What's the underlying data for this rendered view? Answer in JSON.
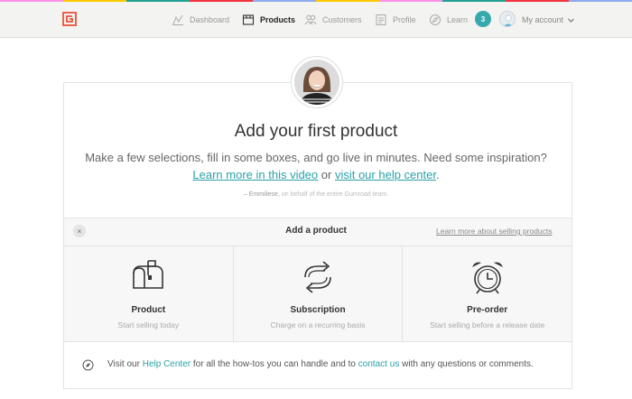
{
  "colors": {
    "rainbow": [
      "#ff90e8",
      "#ffc900",
      "#23a094",
      "#f1333f",
      "#90a8ed",
      "#ffc900",
      "#ff90e8",
      "#23a094",
      "#f1333f",
      "#90a8ed"
    ],
    "accent": "#36a9ae",
    "link": "#2aa1a8"
  },
  "header": {
    "logo_icon": "gumroad-logo-icon",
    "nav": [
      {
        "label": "Dashboard",
        "icon": "chart-icon"
      },
      {
        "label": "Products",
        "icon": "box-icon",
        "active": true
      },
      {
        "label": "Customers",
        "icon": "users-icon"
      },
      {
        "label": "Profile",
        "icon": "profile-icon"
      },
      {
        "label": "Learn",
        "icon": "compass-icon"
      }
    ],
    "notifications_count": "3",
    "account_label": "My account"
  },
  "hero": {
    "title": "Add your first product",
    "subtitle_line1": "Make a few selections, fill in some boxes, and go live in minutes. Need some inspiration?",
    "link_video": "Learn more in this video",
    "or_text": " or ",
    "link_help": "visit our help center",
    "period": ".",
    "signature_name": "– Emmiliese,",
    "signature_rest": " on behalf of the entire Gumroad team."
  },
  "add_product": {
    "close_icon": "×",
    "title": "Add a product",
    "learn_link": "Learn more about selling products"
  },
  "options": [
    {
      "title": "Product",
      "desc": "Start selling today",
      "icon": "mailbox-icon"
    },
    {
      "title": "Subscription",
      "desc": "Charge on a recurring basis",
      "icon": "recurring-arrows-icon"
    },
    {
      "title": "Pre-order",
      "desc": "Start selling before a release date",
      "icon": "alarm-clock-icon"
    }
  ],
  "help": {
    "prefix": "Visit our ",
    "help_center": "Help Center",
    "middle": " for all the how-tos you can handle and to ",
    "contact": "contact us",
    "suffix": " with any questions or comments."
  }
}
